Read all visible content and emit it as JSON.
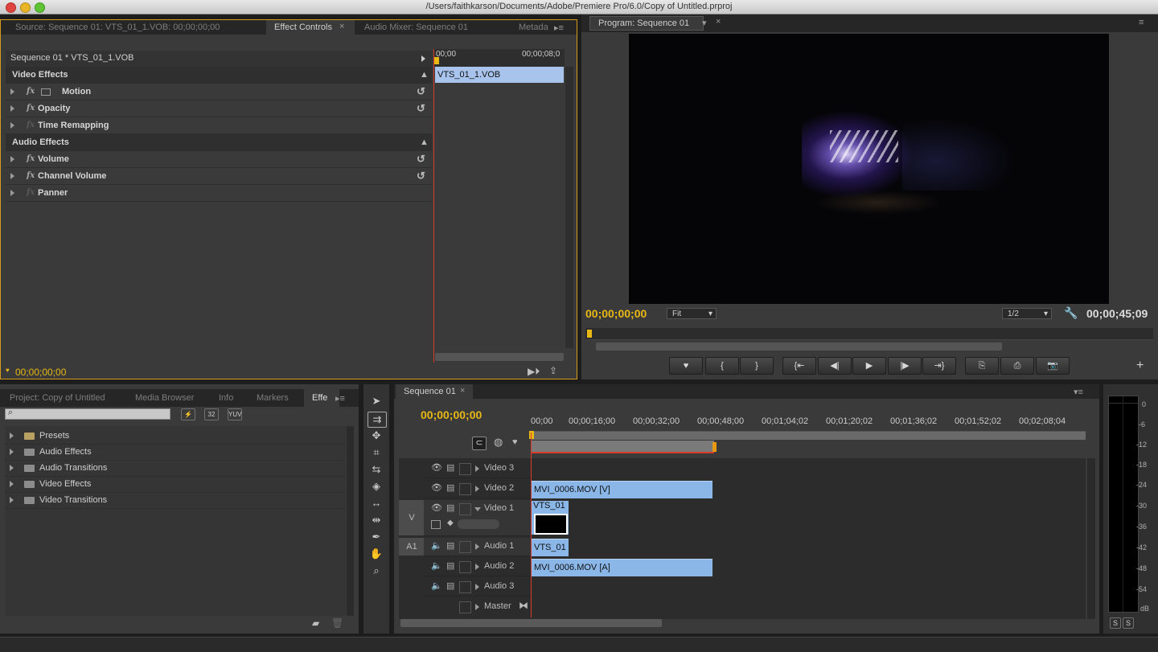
{
  "window": {
    "title": "/Users/faithkarson/Documents/Adobe/Premiere Pro/6.0/Copy of Untitled.prproj"
  },
  "source_panel": {
    "tabs": [
      {
        "label": "Source: Sequence 01: VTS_01_1.VOB: 00;00;00;00"
      },
      {
        "label": "Effect Controls"
      },
      {
        "label": "Audio Mixer: Sequence 01"
      },
      {
        "label": "Metada"
      }
    ],
    "header": "Sequence 01 * VTS_01_1.VOB",
    "time_start": "00;00",
    "time_end": "00;00;08;0",
    "clip_label": "VTS_01_1.VOB",
    "video_section": "Video Effects",
    "video_effects": [
      {
        "label": "Motion"
      },
      {
        "label": "Opacity"
      },
      {
        "label": "Time Remapping"
      }
    ],
    "audio_section": "Audio Effects",
    "audio_effects": [
      {
        "label": "Volume"
      },
      {
        "label": "Channel Volume"
      },
      {
        "label": "Panner"
      }
    ],
    "timecode": "00;00;00;00"
  },
  "program_monitor": {
    "tab": "Program: Sequence 01",
    "timecode_current": "00;00;00;00",
    "fit": "Fit",
    "resolution": "1/2",
    "timecode_duration": "00;00;45;09"
  },
  "project_panel": {
    "tabs": [
      {
        "label": "Project: Copy of Untitled"
      },
      {
        "label": "Media Browser"
      },
      {
        "label": "Info"
      },
      {
        "label": "Markers"
      },
      {
        "label": "Effe"
      }
    ],
    "search_placeholder": "",
    "badges": [
      "32",
      "YUV"
    ],
    "items": [
      {
        "label": "Presets"
      },
      {
        "label": "Audio Effects"
      },
      {
        "label": "Audio Transitions"
      },
      {
        "label": "Video Effects"
      },
      {
        "label": "Video Transitions"
      }
    ]
  },
  "timeline": {
    "tab": "Sequence 01",
    "timecode": "00;00;00;00",
    "ruler": [
      "00;00",
      "00;00;16;00",
      "00;00;32;00",
      "00;00;48;00",
      "00;01;04;02",
      "00;01;20;02",
      "00;01;36;02",
      "00;01;52;02",
      "00;02;08;04"
    ],
    "source_video": "V",
    "source_audio": "A1",
    "tracks": {
      "video3": "Video 3",
      "video2": "Video 2",
      "video1": "Video 1",
      "audio1": "Audio 1",
      "audio2": "Audio 2",
      "audio3": "Audio 3",
      "master": "Master"
    },
    "clips": {
      "v2": "MVI_0006.MOV [V]",
      "v1": "VTS_01",
      "a1": "VTS_01",
      "a2": "MVI_0006.MOV [A]"
    }
  },
  "audio_meter": {
    "scale": [
      "0",
      "-6",
      "-12",
      "-18",
      "-24",
      "-30",
      "-36",
      "-42",
      "-48",
      "-54",
      "dB"
    ],
    "solo_labels": [
      "S",
      "S"
    ]
  },
  "colors": {
    "accent": "#e8b814",
    "clip": "#8ab6e8",
    "playhead": "#d83b2b"
  }
}
